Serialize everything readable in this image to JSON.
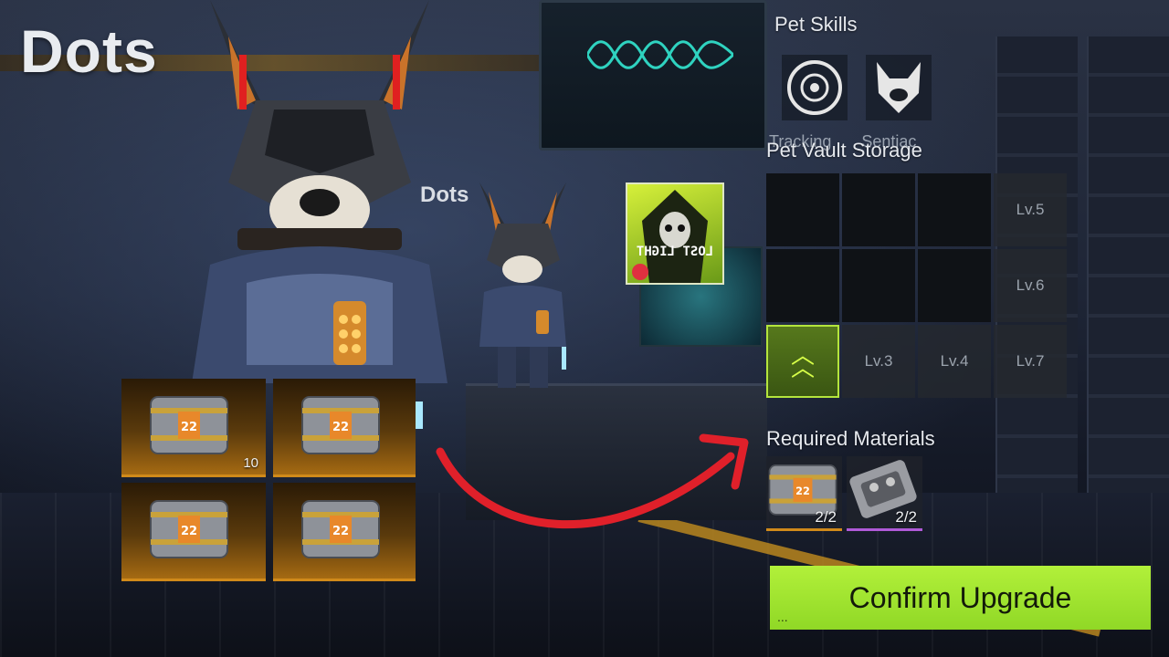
{
  "pet": {
    "name_large": "Dots",
    "name_small": "Dots"
  },
  "inventory": {
    "items": [
      {
        "icon": "crate-icon",
        "badge": "22",
        "count": "10"
      },
      {
        "icon": "crate-icon",
        "badge": "22",
        "count": ""
      },
      {
        "icon": "crate-icon",
        "badge": "22",
        "count": ""
      },
      {
        "icon": "crate-icon",
        "badge": "22",
        "count": ""
      }
    ]
  },
  "thumbnail": {
    "text": "LOST LIGHT"
  },
  "pet_skills": {
    "title": "Pet Skills",
    "skills": [
      {
        "icon": "tracking-icon",
        "name": "Tracking"
      },
      {
        "icon": "wolf-head-icon",
        "name": "Sentiac"
      }
    ]
  },
  "vault": {
    "title": "Pet Vault Storage",
    "cells": [
      {
        "state": "open",
        "label": ""
      },
      {
        "state": "open",
        "label": ""
      },
      {
        "state": "open",
        "label": ""
      },
      {
        "state": "locked",
        "label": "Lv.5"
      },
      {
        "state": "open",
        "label": ""
      },
      {
        "state": "open",
        "label": ""
      },
      {
        "state": "open",
        "label": ""
      },
      {
        "state": "locked",
        "label": "Lv.6"
      },
      {
        "state": "upgrade",
        "label": ""
      },
      {
        "state": "locked",
        "label": "Lv.3"
      },
      {
        "state": "locked",
        "label": "Lv.4"
      },
      {
        "state": "locked",
        "label": "Lv.7"
      }
    ]
  },
  "materials": {
    "title": "Required Materials",
    "items": [
      {
        "icon": "crate-icon",
        "badge": "22",
        "count": "2/2"
      },
      {
        "icon": "toolkit-icon",
        "count": "2/2"
      }
    ]
  },
  "confirm_button": {
    "label": "Confirm Upgrade",
    "dots": "..."
  },
  "colors": {
    "accent_green": "#a6e832",
    "rarity_orange": "#d08a1a",
    "rarity_purple": "#b05ad8",
    "arrow_red": "#e0202a"
  }
}
